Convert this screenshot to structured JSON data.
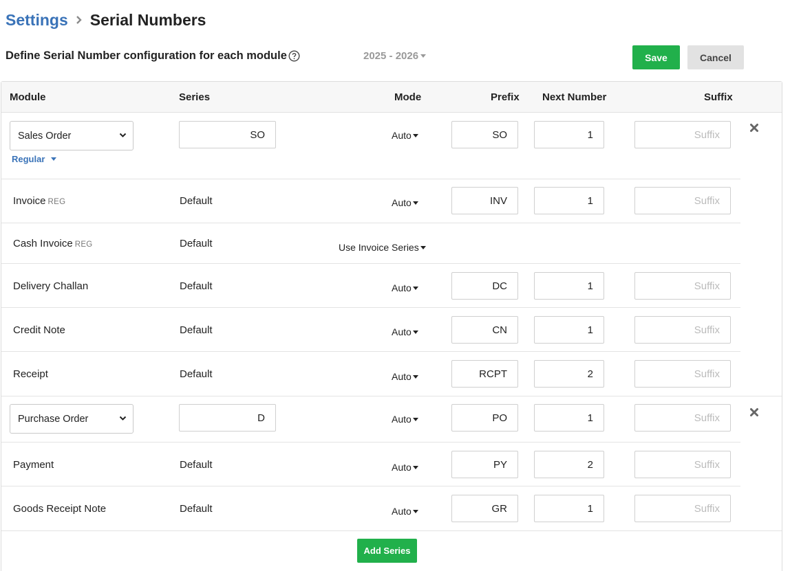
{
  "breadcrumb": {
    "parent": "Settings",
    "current": "Serial Numbers"
  },
  "subheader": {
    "text": "Define Serial Number configuration for each module"
  },
  "financial_year": "2025 - 2026",
  "toolbar": {
    "save_label": "Save",
    "cancel_label": "Cancel",
    "add_series_label": "Add Series"
  },
  "columns": {
    "module": "Module",
    "series": "Series",
    "mode": "Mode",
    "prefix": "Prefix",
    "next_number": "Next Number",
    "suffix": "Suffix"
  },
  "groups": [
    {
      "module": "Sales Order",
      "series": "SO",
      "mode": "Auto",
      "prefix": "SO",
      "next_number": "1",
      "suffix_placeholder": "Suffix",
      "variant": "Regular",
      "rows": [
        {
          "module": "Invoice",
          "tag": "REG",
          "series": "Default",
          "mode": "Auto",
          "prefix": "INV",
          "next_number": "1",
          "suffix_placeholder": "Suffix"
        },
        {
          "module": "Cash Invoice",
          "tag": "REG",
          "series": "Default",
          "mode": "Use Invoice Series"
        },
        {
          "module": "Delivery Challan",
          "series": "Default",
          "mode": "Auto",
          "prefix": "DC",
          "next_number": "1",
          "suffix_placeholder": "Suffix"
        },
        {
          "module": "Credit Note",
          "series": "Default",
          "mode": "Auto",
          "prefix": "CN",
          "next_number": "1",
          "suffix_placeholder": "Suffix"
        },
        {
          "module": "Receipt",
          "series": "Default",
          "mode": "Auto",
          "prefix": "RCPT",
          "next_number": "2",
          "suffix_placeholder": "Suffix"
        }
      ]
    },
    {
      "module": "Purchase Order",
      "series": "D",
      "mode": "Auto",
      "prefix": "PO",
      "next_number": "1",
      "suffix_placeholder": "Suffix",
      "rows": [
        {
          "module": "Payment",
          "series": "Default",
          "mode": "Auto",
          "prefix": "PY",
          "next_number": "2",
          "suffix_placeholder": "Suffix"
        },
        {
          "module": "Goods Receipt Note",
          "series": "Default",
          "mode": "Auto",
          "prefix": "GR",
          "next_number": "1",
          "suffix_placeholder": "Suffix"
        }
      ]
    }
  ],
  "colors": {
    "accent": "#3a73b8",
    "save": "#21b04b",
    "cancel": "#e2e2e2"
  },
  "icons": {
    "breadcrumb_separator": "chevron-right-icon",
    "help": "help-circle-icon",
    "remove": "close-icon",
    "dropdown": "chevron-down-icon"
  }
}
